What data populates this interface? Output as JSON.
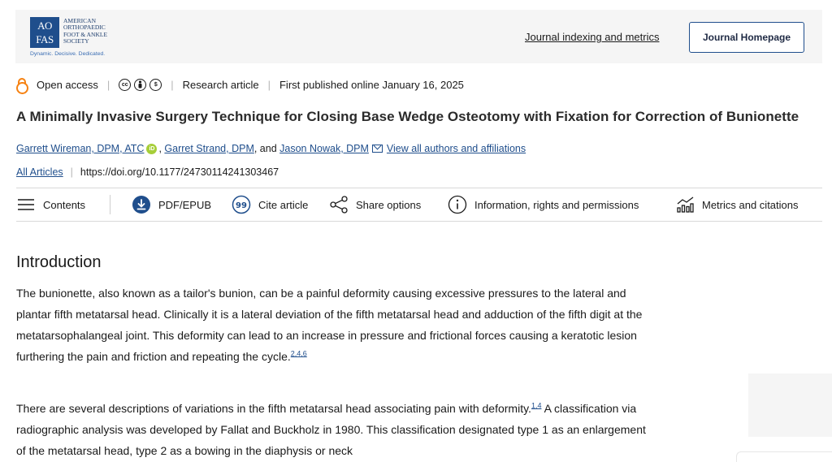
{
  "header": {
    "logo": {
      "mark_top": "AO",
      "mark_bottom": "FAS",
      "words": [
        "American",
        "Orthopaedic",
        "Foot & Ankle",
        "Society"
      ],
      "tagline": "Dynamic. Decisive. Dedicated."
    },
    "indexing_link": "Journal indexing and metrics",
    "homepage_button": "Journal Homepage"
  },
  "meta": {
    "access": "Open access",
    "license_icons": [
      "cc-icon",
      "by-icon",
      "nc-icon"
    ],
    "article_type": "Research article",
    "published": "First published online January 16, 2025"
  },
  "article": {
    "title": "A Minimally Invasive Surgery Technique for Closing Base Wedge Osteotomy with Fixation for Correction of Bunionette",
    "authors": {
      "author1": "Garrett Wireman, DPM, ATC",
      "separator1": ",",
      "author2": "Garret Strand, DPM",
      "separator2": ", and",
      "author3": "Jason Nowak, DPM",
      "view_all": "View all authors and affiliations"
    },
    "all_articles": "All Articles",
    "doi": "https://doi.org/10.1177/24730114241303467"
  },
  "toolbar": {
    "contents": "Contents",
    "pdf": "PDF/EPUB",
    "cite": "Cite article",
    "share": "Share options",
    "info": "Information, rights and permissions",
    "metrics": "Metrics and citations"
  },
  "body": {
    "heading": "Introduction",
    "para1_text": "The bunionette, also known as a tailor's bunion, can be a painful deformity causing excessive pressures to the lateral and plantar fifth metatarsal head. Clinically it is a lateral deviation of the fifth metatarsal head and adduction of the fifth digit at the metatarsophalangeal joint. This deformity can lead to an increase in pressure and frictional forces causing a keratotic lesion furthering the pain and friction and repeating the cycle.",
    "para1_refs": "2,4,6",
    "para2_text_a": "There are several descriptions of variations in the fifth metatarsal head associating pain with deformity.",
    "para2_refs": "1,4",
    "para2_text_b": " A classification via radiographic analysis was developed by Fallat and Buckholz in 1980. This classification designated type 1 as an enlargement of the metatarsal head, type 2 as a bowing in the diaphysis or neck"
  },
  "colors": {
    "link": "#1f4e8c",
    "open_access": "#f68212",
    "orcid": "#a6ce39",
    "header_band": "#f5f5f5"
  }
}
